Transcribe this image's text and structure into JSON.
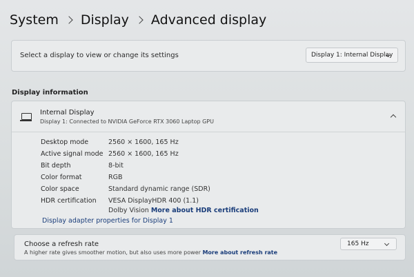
{
  "breadcrumb": {
    "items": [
      "System",
      "Display",
      "Advanced display"
    ]
  },
  "select_display": {
    "label": "Select a display to view or change its settings",
    "dropdown_value": "Display 1: Internal Display"
  },
  "display_information": {
    "section_title": "Display information",
    "display_name": "Internal Display",
    "display_subtitle": "Display 1: Connected to NVIDIA GeForce RTX 3060 Laptop GPU",
    "properties": [
      {
        "key": "Desktop mode",
        "value": "2560 × 1600, 165 Hz"
      },
      {
        "key": "Active signal mode",
        "value": "2560 × 1600, 165 Hz"
      },
      {
        "key": "Bit depth",
        "value": "8-bit"
      },
      {
        "key": "Color format",
        "value": "RGB"
      },
      {
        "key": "Color space",
        "value": "Standard dynamic range (SDR)"
      },
      {
        "key": "HDR certification",
        "value": "VESA DisplayHDR 400 (1.1)"
      }
    ],
    "hdr_extra": "Dolby Vision",
    "hdr_link": "More about HDR certification",
    "adapter_link": "Display adapter properties for Display 1"
  },
  "refresh_rate": {
    "title": "Choose a refresh rate",
    "subtitle": "A higher rate gives smoother motion, but also uses more power",
    "link": "More about refresh rate",
    "value": "165 Hz"
  },
  "icons": {
    "monitor": "monitor-icon",
    "chevron": "chevron-down-icon",
    "collapse": "chevron-up-icon"
  }
}
